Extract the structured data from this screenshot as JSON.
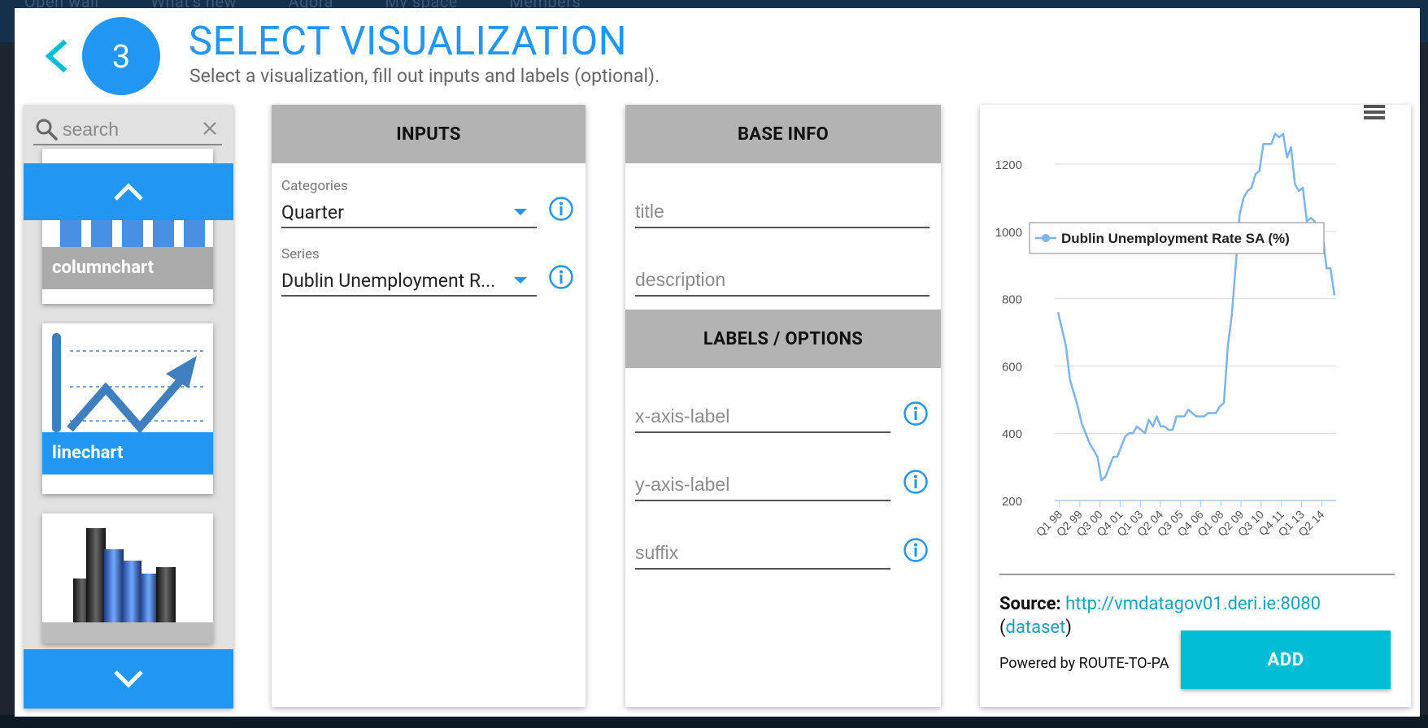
{
  "background": {
    "nav_items": [
      "Open wall",
      "What's new",
      "Agora",
      "My space",
      "Members"
    ]
  },
  "header": {
    "step_number": "3",
    "title": "SELECT VISUALIZATION",
    "subtitle": "Select a visualization, fill out inputs and labels (optional)."
  },
  "gallery": {
    "search_placeholder": "search",
    "cards": [
      {
        "label": "columnchart",
        "selected": false
      },
      {
        "label": "linechart",
        "selected": true
      },
      {
        "label": "",
        "selected": false
      }
    ]
  },
  "inputs_panel": {
    "header": "INPUTS",
    "categories_label": "Categories",
    "categories_value": "Quarter",
    "series_label": "Series",
    "series_value": "Dublin Unemployment R..."
  },
  "base_info_panel": {
    "header": "BASE INFO",
    "title_placeholder": "title",
    "description_placeholder": "description"
  },
  "labels_panel": {
    "header": "LABELS / OPTIONS",
    "x_axis_placeholder": "x-axis-label",
    "y_axis_placeholder": "y-axis-label",
    "suffix_placeholder": "suffix"
  },
  "preview": {
    "source_label": "Source:",
    "source_link": "http://vmdatagov01.deri.ie:8080",
    "dataset_open": "(",
    "dataset_link": "dataset",
    "dataset_close": ")",
    "powered_by": "Powered by ROUTE-TO-PA",
    "add_button": "ADD"
  },
  "colors": {
    "accent": "#2196f3",
    "add_button": "#00bcd4",
    "panel_header": "#b3b3b3",
    "line": "#7cb5ec"
  },
  "chart_data": {
    "type": "line",
    "title": "",
    "xlabel": "",
    "ylabel": "",
    "ylim": [
      200,
      1300
    ],
    "yticks": [
      200,
      400,
      600,
      800,
      1000,
      1200
    ],
    "x_tick_labels": [
      "Q1 98",
      "Q2 99",
      "Q3 00",
      "Q4 01",
      "Q1 03",
      "Q2 04",
      "Q3 05",
      "Q4 06",
      "Q1 08",
      "Q2 09",
      "Q3 10",
      "Q4 11",
      "Q1 13",
      "Q2 14"
    ],
    "legend_position": "top-left",
    "grid": true,
    "series": [
      {
        "name": "Dublin Unemployment Rate SA (%)",
        "values": [
          760,
          710,
          660,
          560,
          520,
          480,
          430,
          400,
          370,
          350,
          330,
          260,
          270,
          300,
          330,
          330,
          360,
          390,
          400,
          400,
          420,
          410,
          400,
          440,
          420,
          450,
          420,
          420,
          410,
          410,
          450,
          450,
          450,
          470,
          460,
          450,
          450,
          450,
          460,
          460,
          460,
          480,
          490,
          660,
          750,
          900,
          1050,
          1100,
          1120,
          1130,
          1170,
          1180,
          1260,
          1260,
          1260,
          1290,
          1280,
          1290,
          1220,
          1250,
          1140,
          1120,
          1130,
          1030,
          1040,
          1030,
          980,
          990,
          890,
          890,
          810
        ]
      }
    ]
  }
}
